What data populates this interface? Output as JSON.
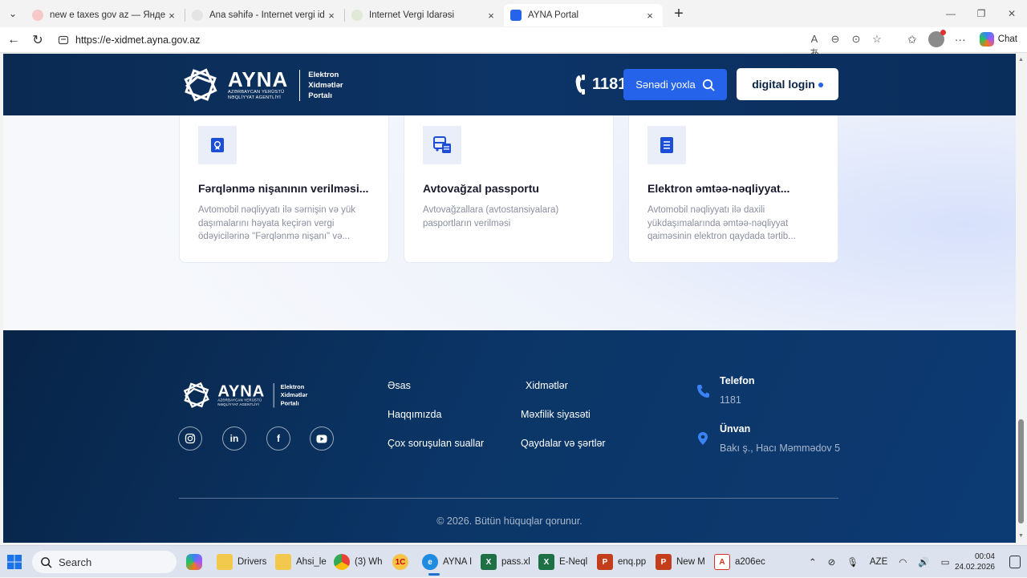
{
  "browser": {
    "tabs": [
      {
        "title": "new e taxes gov az — Яндекс: наш",
        "favicon_color": "#f26b6b",
        "active": false
      },
      {
        "title": "Ana səhifə - İnternet vergi idarəsi",
        "favicon_color": "#d9d9d9",
        "active": false
      },
      {
        "title": "İnternet Vergi İdarəsi",
        "favicon_color": "#d4e4c6",
        "active": false
      },
      {
        "title": "AYNA Portal",
        "favicon_color": "#2563eb",
        "active": true
      }
    ],
    "url": "https://e-xidmet.ayna.gov.az",
    "chat_label": "Chat"
  },
  "header": {
    "logo_word": "AYNA",
    "logo_small_1": "AZƏRBAYCAN YERÜSTÜ",
    "logo_small_2": "NƏQLİYYAT AGENTLİYİ",
    "logo_sub_1": "Elektron",
    "logo_sub_2": "Xidmətlər",
    "logo_sub_3": "Portalı",
    "phone": "1181",
    "check_button": "Sənədi yoxla",
    "login_button": "digital login"
  },
  "cards": [
    {
      "title": "Fərqlənmə nişanının verilməsi...",
      "desc": "Avtomobil nəqliyyatı ilə sərnişin və yük daşımalarını həyata keçirən vergi ödəyicilərinə \"Fərqlənmə nişanı\" və...",
      "icon": "award-certificate-icon"
    },
    {
      "title": "Avtovağzal passportu",
      "desc": "Avtovağzallara (avtostansiyalara) pasportların verilməsi",
      "icon": "bus-station-icon"
    },
    {
      "title": "Elektron əmtəə-nəqliyyat...",
      "desc": "Avtomobil nəqliyyatı ilə daxili yükdaşımalarında əmtəə-nəqliyyat qaiməsinin elektron qaydada tərtib...",
      "icon": "document-icon"
    }
  ],
  "footer": {
    "links_col1": [
      "Əsas",
      "Haqqımızda",
      "Çox soruşulan suallar"
    ],
    "links_col2": [
      "Xidmətlər",
      "Məxfilik siyasəti",
      "Qaydalar və şərtlər"
    ],
    "phone_label": "Telefon",
    "phone_value": "1181",
    "address_label": "Ünvan",
    "address_value": "Bakı ş., Hacı Məmmədov 5",
    "copyright": "© 2026. Bütün hüquqlar qorunur.",
    "social": [
      "instagram-icon",
      "linkedin-icon",
      "facebook-icon",
      "youtube-icon"
    ]
  },
  "taskbar": {
    "search_placeholder": "Search",
    "apps": [
      {
        "label": "Drivers",
        "icon": "folder-icon",
        "color": "#f2c94c"
      },
      {
        "label": "Ahsi_le",
        "icon": "folder-icon",
        "color": "#f2c94c"
      },
      {
        "label": "(3) Wh",
        "icon": "chrome-icon",
        "color": "#e74c3c"
      },
      {
        "label": "",
        "icon": "1c-icon",
        "color": "#f6c343"
      },
      {
        "label": "AYNA I",
        "icon": "edge-icon",
        "color": "#1d8be0"
      },
      {
        "label": "pass.xl",
        "icon": "excel-icon",
        "color": "#1e7145"
      },
      {
        "label": "E-Neql",
        "icon": "excel-icon",
        "color": "#1e7145"
      },
      {
        "label": "enq.pp",
        "icon": "powerpoint-icon",
        "color": "#c43e1c"
      },
      {
        "label": "New M",
        "icon": "powerpoint-icon",
        "color": "#c43e1c"
      },
      {
        "label": "a206ec",
        "icon": "pdf-icon",
        "color": "#d93025"
      }
    ],
    "language": "AZE",
    "time": "00:04",
    "date": "24.02.2026"
  }
}
